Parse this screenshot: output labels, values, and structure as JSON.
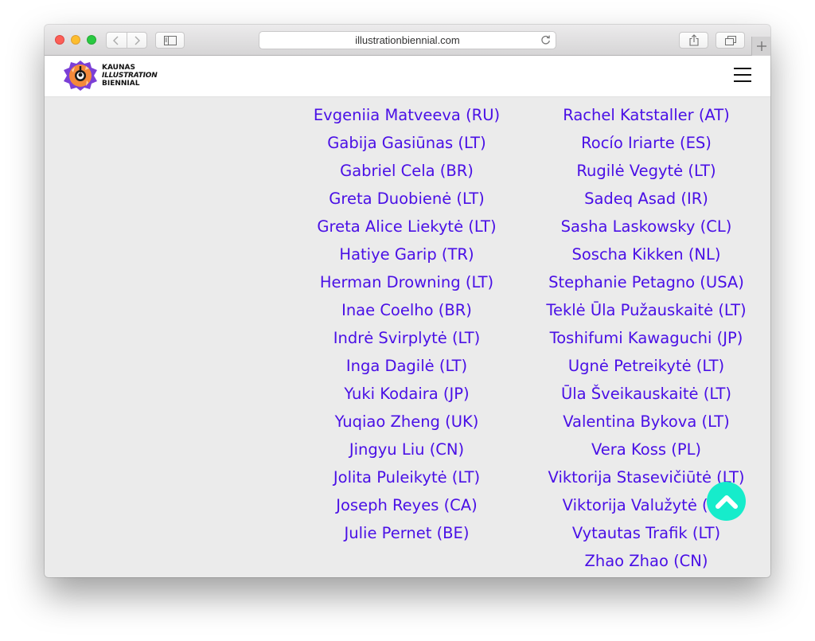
{
  "browser": {
    "url": "illustrationbiennial.com"
  },
  "site": {
    "logo_line1": "KAUNAS",
    "logo_line2": "ILLUSTRATION",
    "logo_line3": "BIENNIAL"
  },
  "artists_left": [
    "Evgeniia Matveeva (RU)",
    "Gabija Gasiūnas (LT)",
    "Gabriel Cela (BR)",
    "Greta Duobienė (LT)",
    "Greta Alice Liekytė (LT)",
    "Hatiye Garip (TR)",
    "Herman Drowning (LT)",
    "Inae Coelho (BR)",
    "Indrė Svirplytė (LT)",
    "Inga Dagilė (LT)",
    "Yuki Kodaira (JP)",
    "Yuqiao Zheng (UK)",
    "Jingyu Liu (CN)",
    "Jolita Puleikytė (LT)",
    "Joseph Reyes (CA)",
    "Julie Pernet (BE)"
  ],
  "artists_right": [
    "Rachel Katstaller (AT)",
    "Rocío Iriarte (ES)",
    "Rugilė Vegytė (LT)",
    "Sadeq Asad (IR)",
    "Sasha Laskowsky (CL)",
    "Soscha Kikken (NL)",
    "Stephanie Petagno (USA)",
    "Teklė Ūla Pužauskaitė (LT)",
    "Toshifumi Kawaguchi (JP)",
    "Ugnė Petreikytė (LT)",
    "Ūla Šveikauskaitė (LT)",
    "Valentina Bykova (LT)",
    "Vera Koss (PL)",
    "Viktorija Stasevičiūtė (LT)",
    "Viktorija Valužytė (LT)",
    "Vytautas Trafik (LT)",
    "Zhao Zhao (CN)"
  ],
  "colors": {
    "link": "#4a10e6",
    "accent": "#16eccb",
    "page_bg": "#ebebeb"
  }
}
